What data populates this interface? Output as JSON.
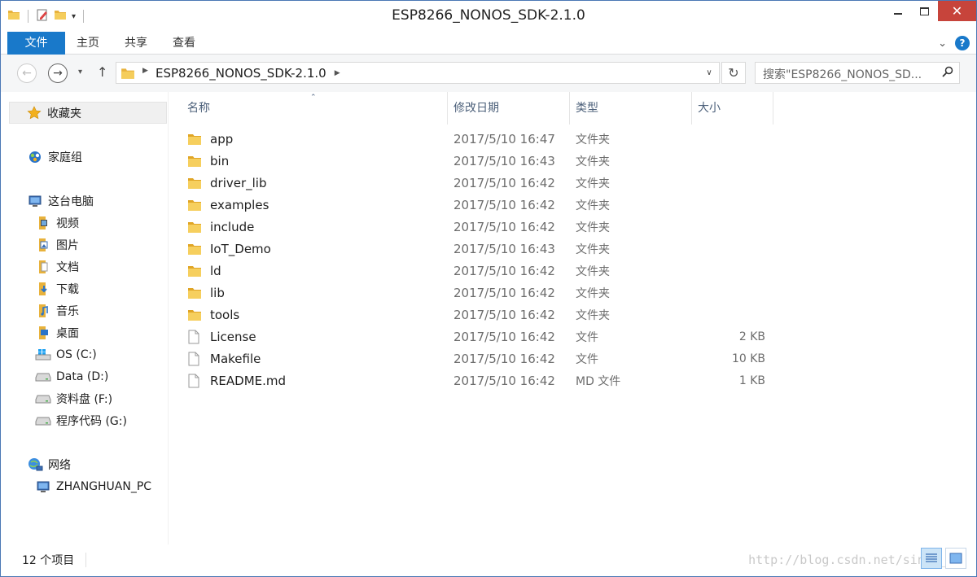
{
  "window": {
    "title": "ESP8266_NONOS_SDK-2.1.0",
    "controls": {
      "minimize": "minimize-icon",
      "maximize": "maximize-icon",
      "close": "✕"
    }
  },
  "ribbon": {
    "tabs": [
      {
        "label": "文件"
      },
      {
        "label": "主页"
      },
      {
        "label": "共享"
      },
      {
        "label": "查看"
      }
    ],
    "accent": "#1979ca"
  },
  "address": {
    "path": "ESP8266_NONOS_SDK-2.1.0",
    "search_placeholder": "搜索\"ESP8266_NONOS_SD...",
    "up": "↑"
  },
  "nav": {
    "favorites": "收藏夹",
    "homegroup": "家庭组",
    "thispc": "这台电脑",
    "items": [
      {
        "label": "视频",
        "icon": "video-folder-icon"
      },
      {
        "label": "图片",
        "icon": "pictures-folder-icon"
      },
      {
        "label": "文档",
        "icon": "documents-folder-icon"
      },
      {
        "label": "下载",
        "icon": "downloads-folder-icon"
      },
      {
        "label": "音乐",
        "icon": "music-folder-icon"
      },
      {
        "label": "桌面",
        "icon": "desktop-folder-icon"
      },
      {
        "label": "OS (C:)",
        "icon": "windows-drive-icon"
      },
      {
        "label": "Data (D:)",
        "icon": "drive-icon"
      },
      {
        "label": "资料盘 (F:)",
        "icon": "drive-icon"
      },
      {
        "label": "程序代码 (G:)",
        "icon": "drive-icon"
      }
    ],
    "network": "网络",
    "pc_name": "ZHANGHUAN_PC"
  },
  "columns": {
    "name": "名称",
    "date": "修改日期",
    "type": "类型",
    "size": "大小"
  },
  "files": [
    {
      "name": "app",
      "date": "2017/5/10 16:47",
      "type": "文件夹",
      "size": "",
      "kind": "folder"
    },
    {
      "name": "bin",
      "date": "2017/5/10 16:43",
      "type": "文件夹",
      "size": "",
      "kind": "folder"
    },
    {
      "name": "driver_lib",
      "date": "2017/5/10 16:42",
      "type": "文件夹",
      "size": "",
      "kind": "folder"
    },
    {
      "name": "examples",
      "date": "2017/5/10 16:42",
      "type": "文件夹",
      "size": "",
      "kind": "folder"
    },
    {
      "name": "include",
      "date": "2017/5/10 16:42",
      "type": "文件夹",
      "size": "",
      "kind": "folder"
    },
    {
      "name": "IoT_Demo",
      "date": "2017/5/10 16:43",
      "type": "文件夹",
      "size": "",
      "kind": "folder"
    },
    {
      "name": "ld",
      "date": "2017/5/10 16:42",
      "type": "文件夹",
      "size": "",
      "kind": "folder"
    },
    {
      "name": "lib",
      "date": "2017/5/10 16:42",
      "type": "文件夹",
      "size": "",
      "kind": "folder"
    },
    {
      "name": "tools",
      "date": "2017/5/10 16:42",
      "type": "文件夹",
      "size": "",
      "kind": "folder"
    },
    {
      "name": "License",
      "date": "2017/5/10 16:42",
      "type": "文件",
      "size": "2 KB",
      "kind": "file"
    },
    {
      "name": "Makefile",
      "date": "2017/5/10 16:42",
      "type": "文件",
      "size": "10 KB",
      "kind": "file"
    },
    {
      "name": "README.md",
      "date": "2017/5/10 16:42",
      "type": "MD 文件",
      "size": "1 KB",
      "kind": "file"
    }
  ],
  "status": {
    "count": "12 个项目"
  },
  "watermark": "http://blog.csdn.net/sinat_32"
}
